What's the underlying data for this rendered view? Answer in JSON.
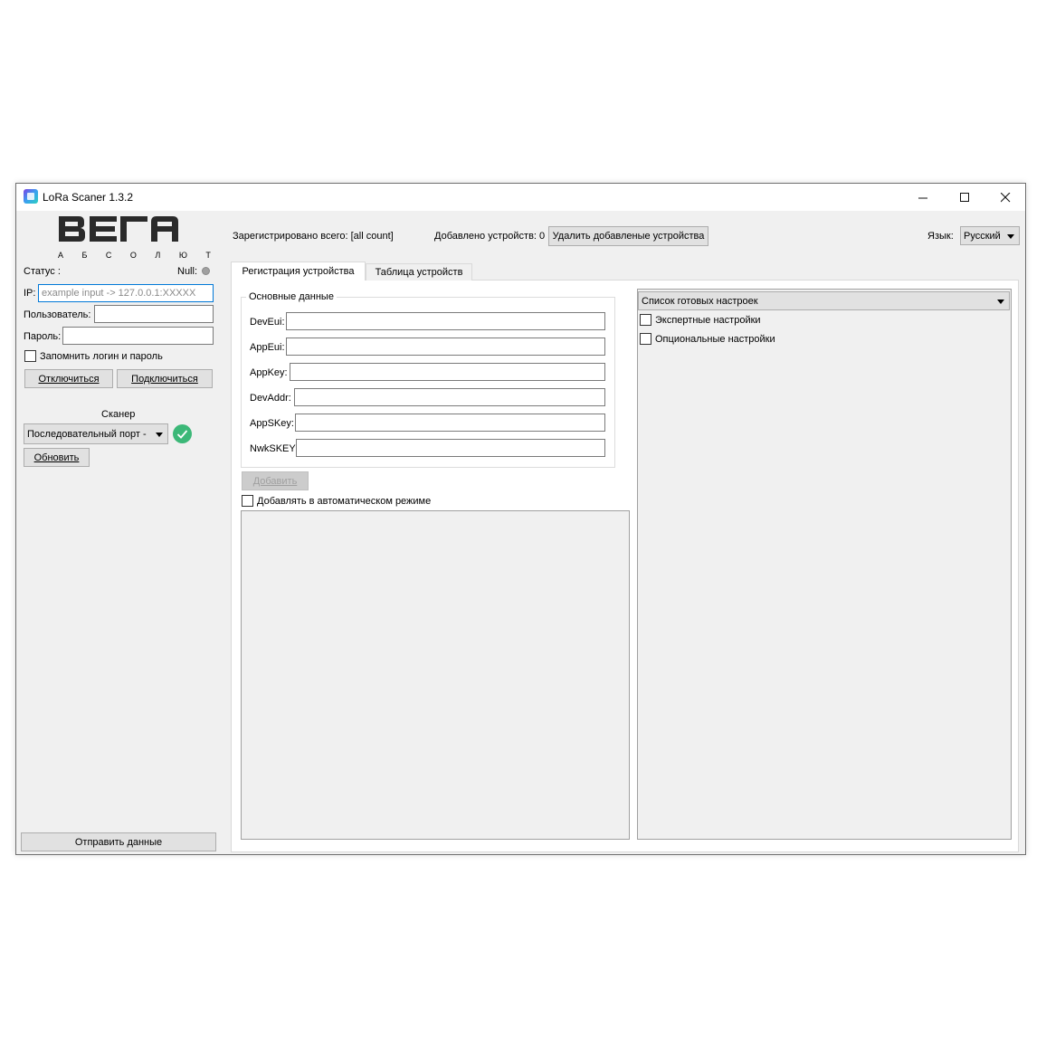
{
  "window": {
    "title": "LoRa Scaner 1.3.2"
  },
  "logo": {
    "brand": "ВЕГА",
    "tagline": "А Б С О Л Ю Т"
  },
  "left_panel": {
    "status_label": "Статус :",
    "null_label": "Null:",
    "ip_label": "IP:",
    "ip_placeholder": "example input -> 127.0.0.1:XXXXX",
    "user_label": "Пользователь:",
    "user_value": "",
    "password_label": "Пароль:",
    "password_value": "",
    "remember_label": "Запомнить логин и пароль",
    "disconnect_label": "Отключиться",
    "connect_label": "Подключиться",
    "scanner_label": "Сканер",
    "port_select_value": "Последовательный порт -",
    "refresh_label": "Обновить",
    "send_label": "Отправить данные"
  },
  "header": {
    "registered_text": "Зарегистрировано всего: [all count]",
    "added_text": "Добавлено устройств: 0",
    "delete_added_label": "Удалить добавленые устройства",
    "language_label": "Язык:",
    "language_value": "Русский"
  },
  "tabs": [
    {
      "label": "Регистрация устройства",
      "active": true
    },
    {
      "label": "Таблица устройств",
      "active": false
    }
  ],
  "registration": {
    "group_title": "Основные данные",
    "fields": [
      {
        "label": "DevEui:",
        "value": ""
      },
      {
        "label": "AppEui:",
        "value": ""
      },
      {
        "label": "AppKey:",
        "value": ""
      },
      {
        "label": "DevAddr:",
        "value": ""
      },
      {
        "label": "AppSKey:",
        "value": ""
      },
      {
        "label": "NwkSKEY:",
        "value": ""
      }
    ],
    "add_label": "Добавить",
    "auto_add_label": "Добавлять в автоматическом режиме"
  },
  "settings_panel": {
    "preset_select_value": "Список готовых настроек",
    "expert_label": "Экспертные настройки",
    "optional_label": "Опциональные настройки"
  },
  "colors": {
    "focus_border": "#0078d7",
    "status_ok": "#3cb878",
    "indicator_null": "#a0a0a0"
  }
}
